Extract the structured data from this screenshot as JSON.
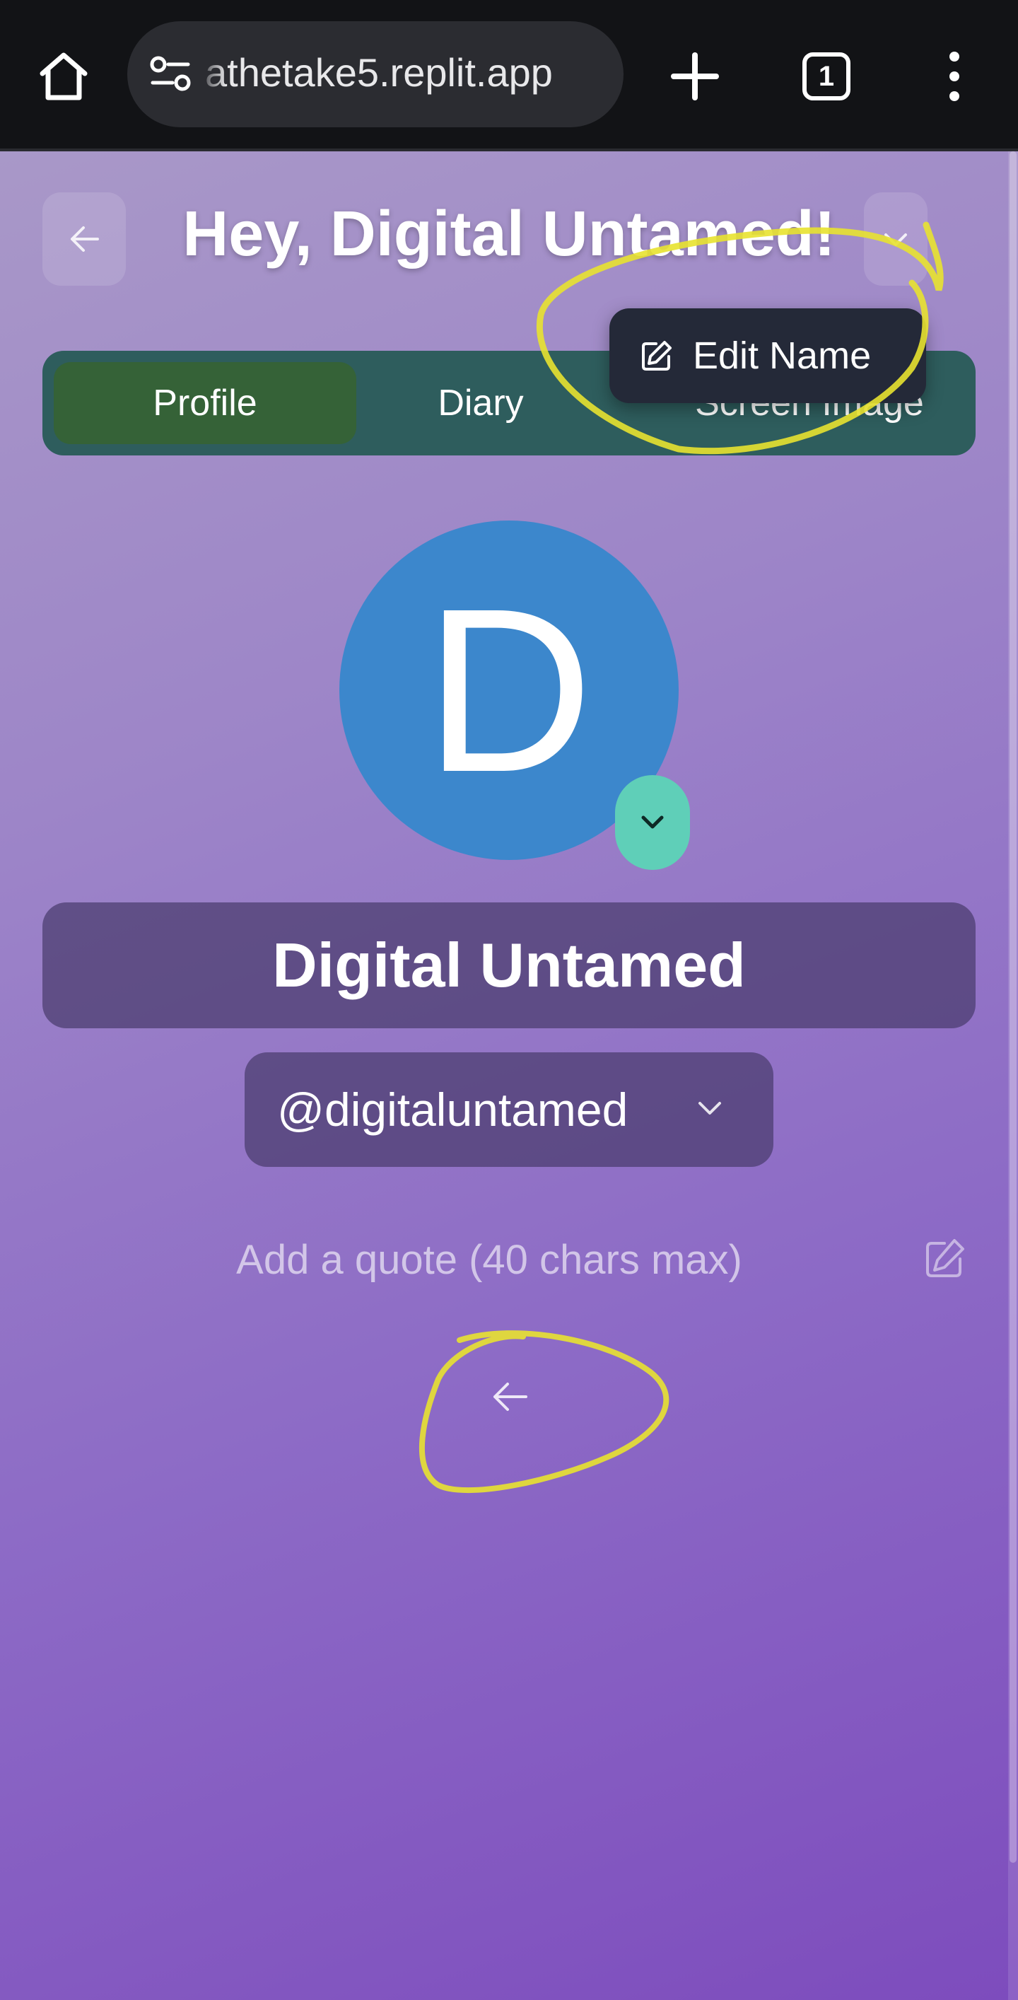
{
  "browser": {
    "url": "athetake5.replit.app",
    "tab_count": "1",
    "icons": [
      "home-icon",
      "site-settings-icon",
      "plus-icon",
      "tabs-icon",
      "more-vert-icon"
    ]
  },
  "header": {
    "greeting": "Hey, Digital Untamed!"
  },
  "tabs": [
    {
      "label": "Profile",
      "active": true
    },
    {
      "label": "Diary",
      "active": false
    },
    {
      "label": "Screen Image",
      "active": false
    }
  ],
  "dropdown": {
    "label": "Edit Name"
  },
  "profile": {
    "initial": "D",
    "name": "Digital Untamed",
    "handle": "@digitaluntamed",
    "quote_placeholder": "Add a quote (40 chars max)"
  },
  "colors": {
    "avatar": "#3c87cc",
    "tab_active": "#356237",
    "tabbar": "#2e5d5d",
    "avatar_toggle": "#5fcfb8",
    "annotation": "#e8e230"
  }
}
